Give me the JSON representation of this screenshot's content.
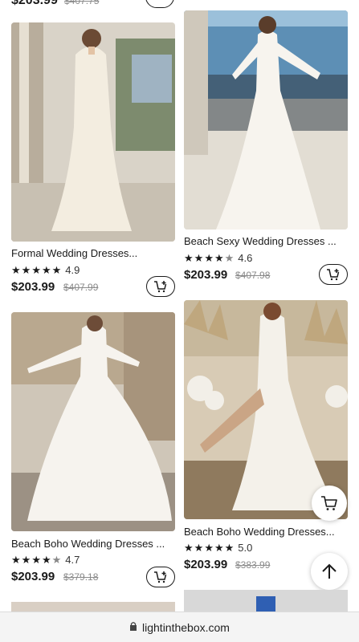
{
  "top_strip": {
    "price": "$203.99",
    "original_price": "$407.75"
  },
  "products": [
    {
      "title": "Formal Wedding Dresses...",
      "rating": "4.9",
      "stars": 5,
      "price": "$203.99",
      "original_price": "$407.99"
    },
    {
      "title": "Beach Sexy Wedding Dresses ...",
      "rating": "4.6",
      "stars": 4.5,
      "price": "$203.99",
      "original_price": "$407.98"
    },
    {
      "title": "Beach Boho Wedding Dresses ...",
      "rating": "4.7",
      "stars": 4.5,
      "price": "$203.99",
      "original_price": "$379.18"
    },
    {
      "title": "Beach Boho Wedding Dresses...",
      "rating": "5.0",
      "stars": 5,
      "price": "$203.99",
      "original_price": "$383.99"
    }
  ],
  "browser": {
    "url": "lightinthebox.com"
  },
  "icons": {
    "cart": "add-to-cart-icon",
    "floating_cart": "cart-icon",
    "back_to_top": "arrow-up-icon",
    "lock": "lock-icon"
  },
  "colors": {
    "text": "#1a1a1a",
    "strike": "#8a8a8a",
    "bar": "#f4f4f4"
  }
}
